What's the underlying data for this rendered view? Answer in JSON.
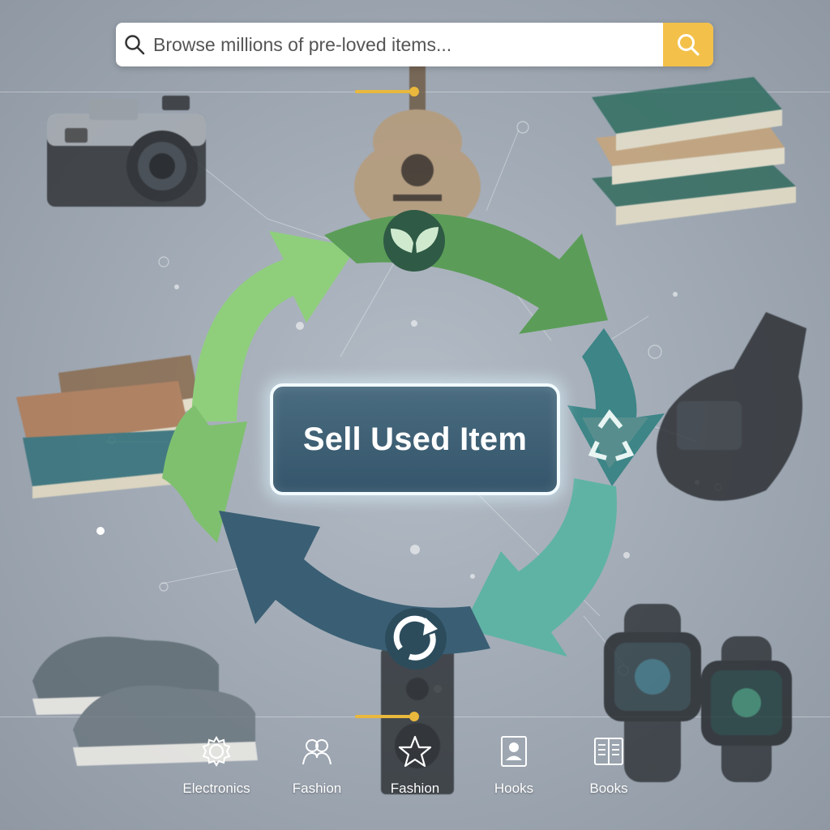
{
  "search": {
    "placeholder": "Browse millions of pre-loved items...",
    "value": ""
  },
  "cta": {
    "label": "Sell Used Item"
  },
  "cycle_icons": [
    "leaf-icon",
    "recycle-icon",
    "refresh-icon"
  ],
  "products": [
    "camera",
    "guitar",
    "books",
    "books",
    "guitar-case",
    "sneakers",
    "speaker",
    "smartwatches"
  ],
  "nav": {
    "items": [
      {
        "label": "Electronics",
        "icon": "gear-icon"
      },
      {
        "label": "Fashion",
        "icon": "people-icon"
      },
      {
        "label": "Fashion",
        "icon": "star-icon"
      },
      {
        "label": "Hooks",
        "icon": "id-card-icon"
      },
      {
        "label": "Books",
        "icon": "book-icon"
      }
    ]
  },
  "colors": {
    "accent": "#f3c04a",
    "cta_bg": "#3d6075",
    "arrow_light_green": "#8fcf7c",
    "arrow_green": "#5b9d58",
    "arrow_teal": "#3d8587",
    "arrow_seafoam": "#5fb3a5",
    "arrow_navy": "#3a5f74"
  }
}
